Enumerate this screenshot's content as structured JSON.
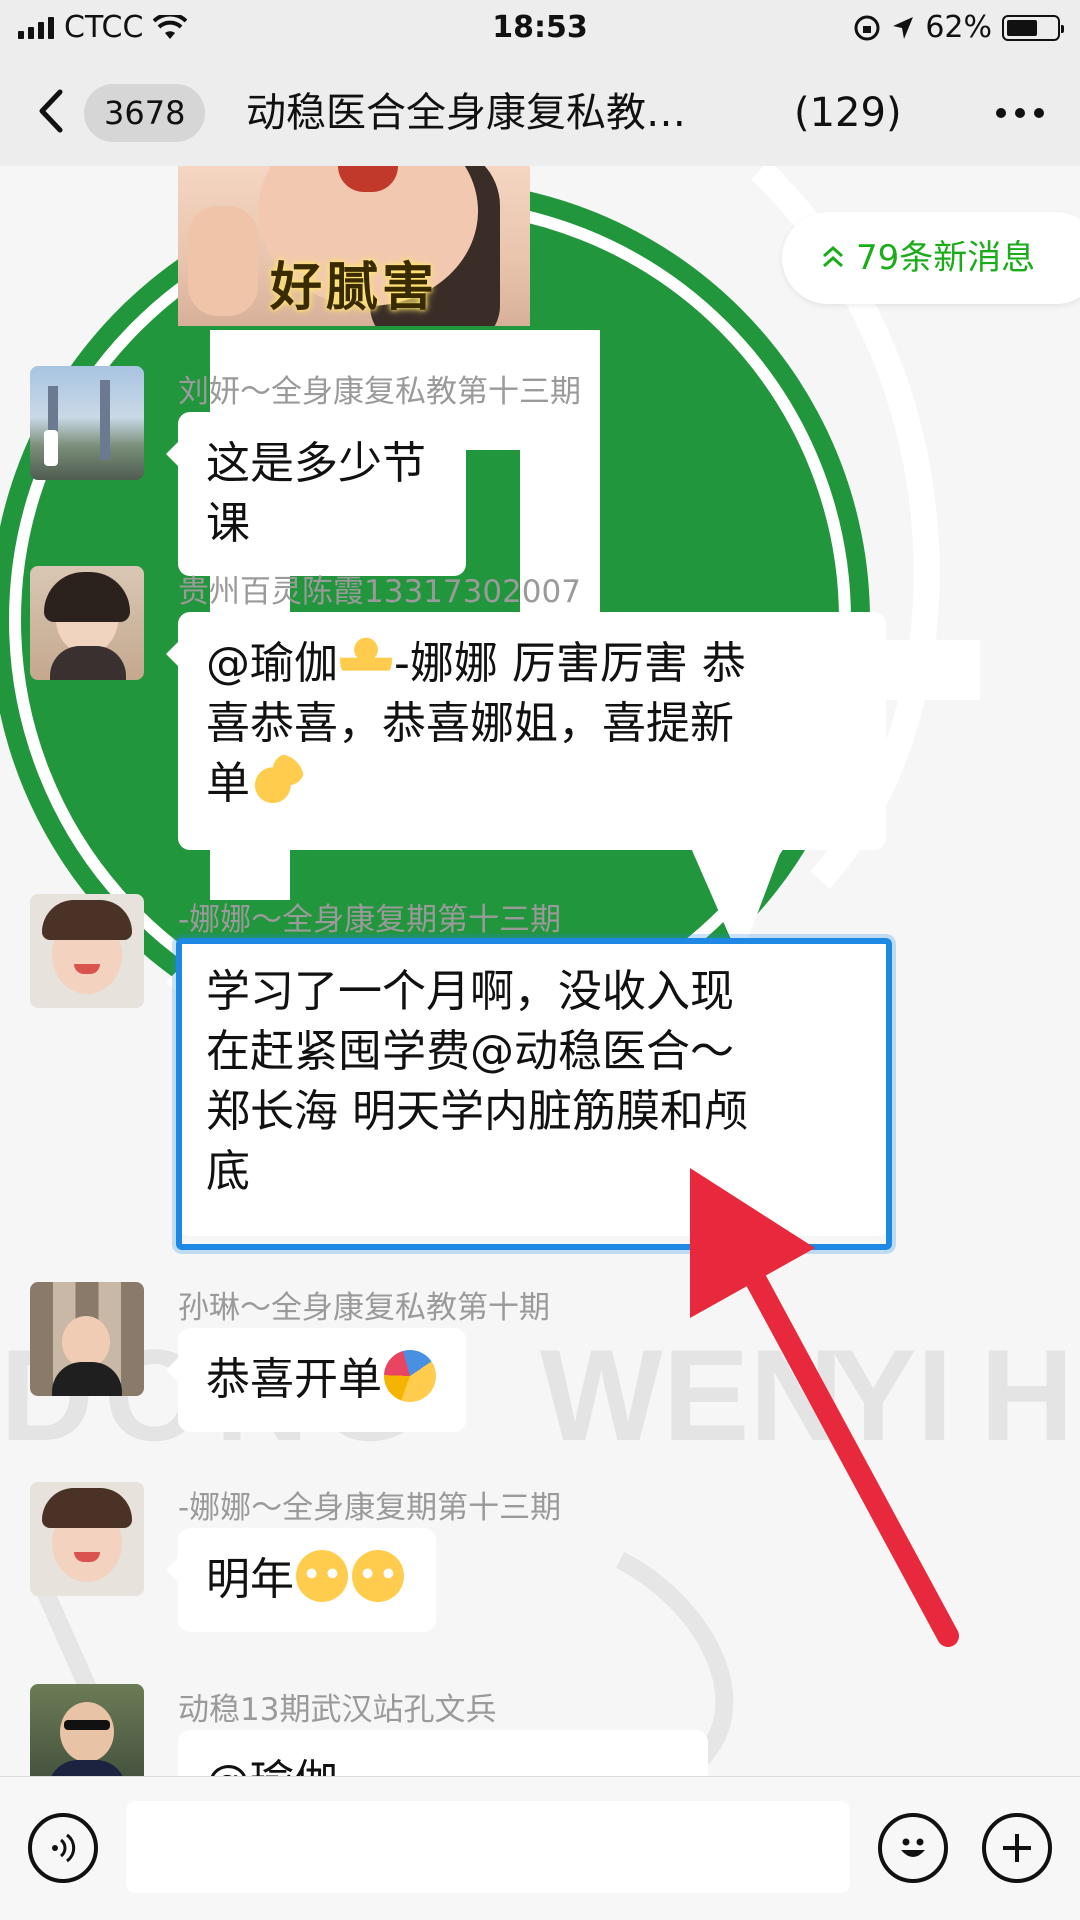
{
  "status_bar": {
    "carrier": "CTCC",
    "time": "18:53",
    "battery": "62%",
    "battery_level": 0.62
  },
  "nav": {
    "unread_count": "3678",
    "title": "动稳医合全身康复私教…",
    "member_count": "(129)"
  },
  "new_messages": {
    "label": "79条新消息"
  },
  "image_message": {
    "caption": "好腻害"
  },
  "messages": [
    {
      "sender": "刘妍～全身康复私教第十三期",
      "text": "这是多少节课"
    },
    {
      "sender": "贵州百灵陈霞13317302007",
      "lines": [
        "@瑜伽",
        "-娜娜 厉害厉害 恭",
        "喜恭喜，恭喜娜姐，喜提新",
        "单"
      ]
    },
    {
      "sender": "-娜娜～全身康复期第十三期",
      "lines": [
        "学习了一个月啊，没收入现",
        "在赶紧囤学费@动稳医合～",
        "郑长海 明天学内脏筋膜和颅",
        "底"
      ]
    },
    {
      "sender": "孙琳～全身康复私教第十期",
      "text": "恭喜开单"
    },
    {
      "sender": "-娜娜～全身康复期第十三期",
      "text": "明年"
    },
    {
      "sender": "动稳13期武汉站孔文兵",
      "text": "@瑜伽"
    }
  ],
  "background_text": [
    "DONG",
    "WEN",
    "YI",
    "HE"
  ],
  "icons": {
    "back": "chevron-left-icon",
    "more": "more-dots-icon",
    "voice": "voice-icon",
    "emoji": "emoji-icon",
    "plus": "plus-icon"
  },
  "colors": {
    "logo_green": "#22963c",
    "accent_green": "#1aad19",
    "highlight_blue": "#1e88e5",
    "arrow_red": "#e8283c"
  }
}
